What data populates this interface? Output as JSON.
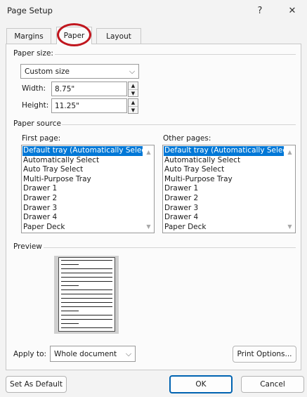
{
  "window": {
    "title": "Page Setup",
    "help_glyph": "?",
    "close_glyph": "✕"
  },
  "tabs": [
    {
      "label": "Margins",
      "active": false
    },
    {
      "label": "Paper",
      "active": true
    },
    {
      "label": "Layout",
      "active": false
    }
  ],
  "paper_size": {
    "group_label": "Paper size:",
    "selected": "Custom size",
    "width_label": "Width:",
    "width_value": "8.75\"",
    "height_label": "Height:",
    "height_value": "11.25\""
  },
  "paper_source": {
    "group_label": "Paper source",
    "first_page_label": "First page:",
    "other_pages_label": "Other pages:",
    "trays": [
      "Default tray (Automatically Select)",
      "Automatically Select",
      "Auto Tray Select",
      "Multi-Purpose Tray",
      "Drawer 1",
      "Drawer 2",
      "Drawer 3",
      "Drawer 4",
      "Paper Deck"
    ],
    "first_page_selected": "Default tray (Automatically Select)",
    "other_pages_selected": "Default tray (Automatically Select)"
  },
  "preview": {
    "label": "Preview"
  },
  "apply_to": {
    "label": "Apply to:",
    "selected": "Whole document"
  },
  "buttons": {
    "print_options": "Print Options...",
    "set_as_default": "Set As Default",
    "ok": "OK",
    "cancel": "Cancel"
  },
  "colors": {
    "selection": "#0078d7",
    "tab_highlight": "#c0161e",
    "ok_border": "#0063b1"
  }
}
